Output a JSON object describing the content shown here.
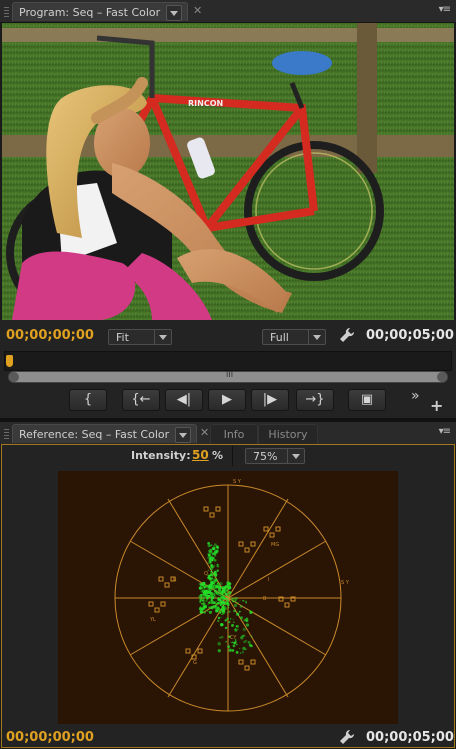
{
  "program_panel": {
    "tab_label": "Program: Seq – Fast Color",
    "timecode_current": "00;00;00;00",
    "timecode_duration": "00;00;05;00",
    "zoom_select": "Fit",
    "quality_select": "Full",
    "scrollbar_grip": "III",
    "more_glyph": "»",
    "add_glyph": "+",
    "transport": {
      "mark_in": "{",
      "go_to_in": "{←",
      "step_back": "◀|",
      "play": "▶",
      "step_forward": "|▶",
      "go_to_out": "→}",
      "export_frame": "▣"
    }
  },
  "reference_panel": {
    "tab_label": "Reference: Seq – Fast Color",
    "tab_info": "Info",
    "tab_history": "History",
    "intensity_label": "Intensity:",
    "intensity_value": "50",
    "intensity_unit": "%",
    "scale_select": "75%",
    "timecode_current": "00;00;00;00",
    "timecode_duration": "00;00;05;00",
    "vectorscope_labels": {
      "r": "R",
      "mg": "MG",
      "b": "B",
      "cy": "CY",
      "g": "G",
      "yl": "YL",
      "sy": "S Y",
      "sy2": "S Y",
      "i": "I",
      "q": "Q"
    }
  },
  "colors": {
    "accent_timecode": "#e0a020",
    "vectorscope_graticule": "#c88a2a",
    "vectorscope_trace": "#22e22a",
    "panel_bg": "#232323"
  }
}
